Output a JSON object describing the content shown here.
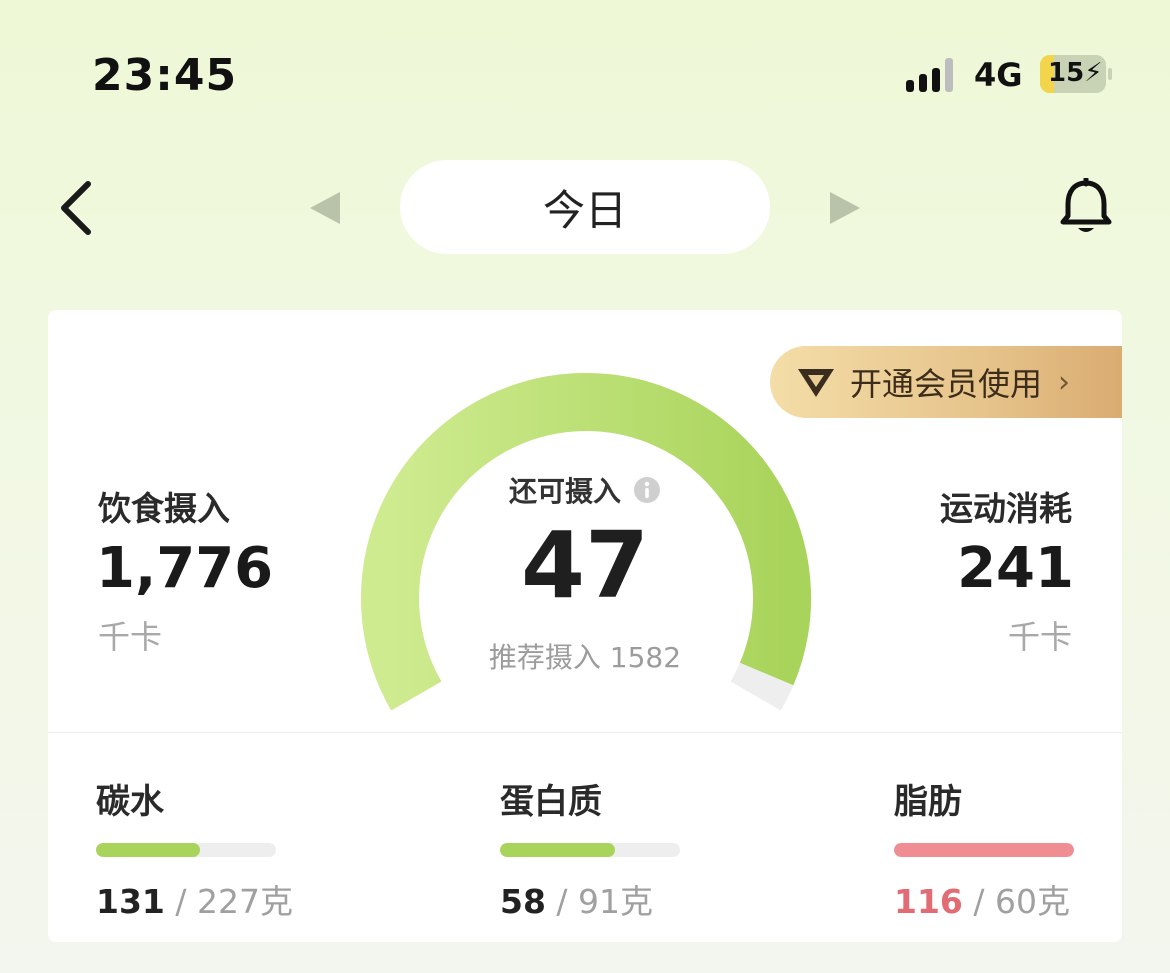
{
  "status_bar": {
    "time": "23:45",
    "network": "4G",
    "battery": "15"
  },
  "nav": {
    "back_icon": "chevron-left-icon",
    "prev_icon": "triangle-left-icon",
    "next_icon": "triangle-right-icon",
    "date_label": "今日",
    "bell_icon": "bell-icon"
  },
  "vip": {
    "icon": "diamond-icon",
    "label": "开通会员使用",
    "chevron": "›"
  },
  "intake": {
    "label": "饮食摄入",
    "value": "1,776",
    "unit": "千卡"
  },
  "burn": {
    "label": "运动消耗",
    "value": "241",
    "unit": "千卡"
  },
  "remaining": {
    "label": "还可摄入",
    "info_icon": "info-icon",
    "value": "47",
    "recommend": "推荐摄入 1582",
    "progress_fraction": 0.97
  },
  "macros": [
    {
      "name": "碳水",
      "value": "131",
      "target": " / 227克",
      "fraction": 0.58,
      "color": "#a9d45b",
      "value_color": "#222222"
    },
    {
      "name": "蛋白质",
      "value": "58",
      "target": " / 91克",
      "fraction": 0.64,
      "color": "#a9d45b",
      "value_color": "#222222"
    },
    {
      "name": "脂肪",
      "value": "116",
      "target": " / 60克",
      "fraction": 1.0,
      "color": "#f08d93",
      "value_color": "#e26c73"
    }
  ],
  "colors": {
    "accent_green": "#a9d45b",
    "over_red": "#f08d93"
  }
}
